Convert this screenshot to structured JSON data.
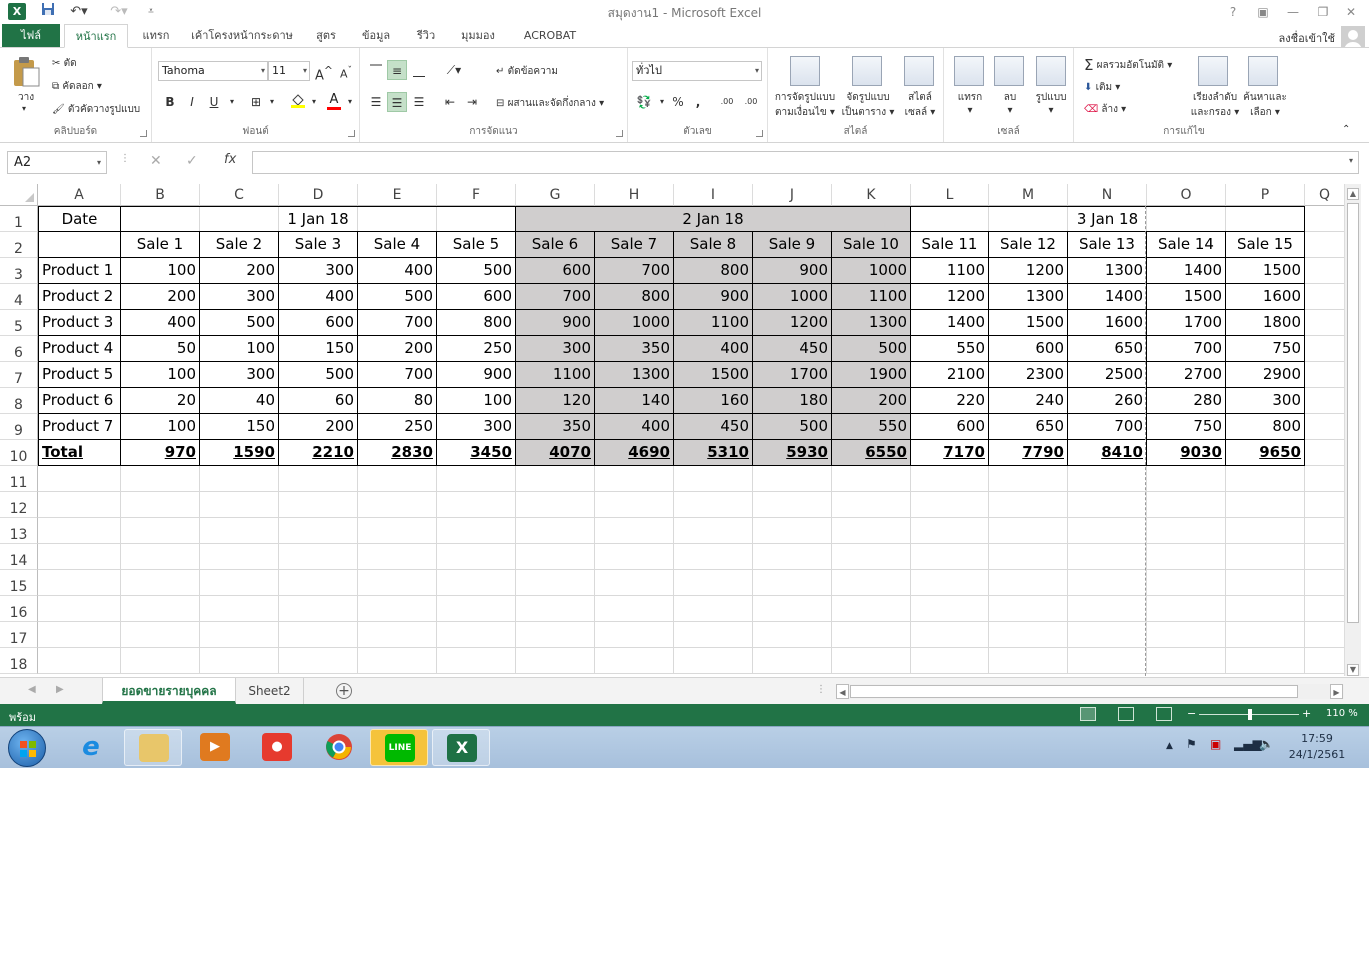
{
  "window": {
    "title": "สมุดงาน1 - Microsoft Excel",
    "app_icon": "X",
    "help": "?",
    "controls": [
      "restore-ribbon",
      "minimize",
      "restore",
      "close"
    ]
  },
  "ribbon_tabs": [
    "ไฟล์",
    "หน้าแรก",
    "แทรก",
    "เค้าโครงหน้ากระดาษ",
    "สูตร",
    "ข้อมูล",
    "รีวิว",
    "มุมมอง",
    "ACROBAT"
  ],
  "signin": "ลงชื่อเข้าใช้",
  "ribbon": {
    "clipboard": {
      "paste": "วาง",
      "cut": "ตัด",
      "copy": "คัดลอก",
      "format_painter": "ตัวคัดวางรูปแบบ",
      "label": "คลิปบอร์ด"
    },
    "font": {
      "name": "Tahoma",
      "size": "11",
      "bold": "B",
      "italic": "I",
      "underline": "U",
      "grow": "A",
      "shrink": "A",
      "font_color_letter": "A",
      "label": "ฟอนต์"
    },
    "alignment": {
      "wrap": "ตัดข้อความ",
      "merge": "ผสานและจัดกึ่งกลาง",
      "label": "การจัดแนว"
    },
    "number": {
      "format": "ทั่วไป",
      "percent": "%",
      "comma": ",",
      "inc": ".00",
      "dec": ".00",
      "label": "ตัวเลข"
    },
    "styles": {
      "cond_1": "การจัดรูปแบบ",
      "cond_2": "ตามเงื่อนไข",
      "table_1": "จัดรูปแบบ",
      "table_2": "เป็นตาราง",
      "cell_1": "สไตล์",
      "cell_2": "เซลล์",
      "label": "สไตล์"
    },
    "cells": {
      "insert": "แทรก",
      "delete": "ลบ",
      "format": "รูปแบบ",
      "label": "เซลล์"
    },
    "editing": {
      "autosum": "ผลรวมอัตโนมัติ",
      "fill": "เติม",
      "clear": "ล้าง",
      "sort_1": "เรียงลำดับ",
      "sort_2": "และกรอง",
      "find_1": "ค้นหาและ",
      "find_2": "เลือก",
      "label": "การแก้ไข"
    }
  },
  "formula_bar": {
    "name_box": "A2",
    "fx": "fx",
    "content": ""
  },
  "sheet": {
    "columns": [
      "A",
      "B",
      "C",
      "D",
      "E",
      "F",
      "G",
      "H",
      "I",
      "J",
      "K",
      "L",
      "M",
      "N",
      "O",
      "P",
      "Q"
    ],
    "row_numbers": [
      "1",
      "2",
      "3",
      "4",
      "5",
      "6",
      "7",
      "8",
      "9",
      "10",
      "11",
      "12",
      "13",
      "14",
      "15",
      "16",
      "17",
      "18"
    ],
    "date_headers": [
      "Date",
      "1 Jan 18",
      "2 Jan 18",
      "3 Jan 18"
    ],
    "sale_headers": [
      "Sale 1",
      "Sale 2",
      "Sale 3",
      "Sale 4",
      "Sale 5",
      "Sale 6",
      "Sale 7",
      "Sale 8",
      "Sale 9",
      "Sale 10",
      "Sale 11",
      "Sale 12",
      "Sale 13",
      "Sale 14",
      "Sale 15"
    ],
    "rows": [
      {
        "label": "Product 1",
        "values": [
          "100",
          "200",
          "300",
          "400",
          "500",
          "600",
          "700",
          "800",
          "900",
          "1000",
          "1100",
          "1200",
          "1300",
          "1400",
          "1500"
        ]
      },
      {
        "label": "Product 2",
        "values": [
          "200",
          "300",
          "400",
          "500",
          "600",
          "700",
          "800",
          "900",
          "1000",
          "1100",
          "1200",
          "1300",
          "1400",
          "1500",
          "1600"
        ]
      },
      {
        "label": "Product 3",
        "values": [
          "400",
          "500",
          "600",
          "700",
          "800",
          "900",
          "1000",
          "1100",
          "1200",
          "1300",
          "1400",
          "1500",
          "1600",
          "1700",
          "1800"
        ]
      },
      {
        "label": "Product 4",
        "values": [
          "50",
          "100",
          "150",
          "200",
          "250",
          "300",
          "350",
          "400",
          "450",
          "500",
          "550",
          "600",
          "650",
          "700",
          "750"
        ]
      },
      {
        "label": "Product 5",
        "values": [
          "100",
          "300",
          "500",
          "700",
          "900",
          "1100",
          "1300",
          "1500",
          "1700",
          "1900",
          "2100",
          "2300",
          "2500",
          "2700",
          "2900"
        ]
      },
      {
        "label": "Product 6",
        "values": [
          "20",
          "40",
          "60",
          "80",
          "100",
          "120",
          "140",
          "160",
          "180",
          "200",
          "220",
          "240",
          "260",
          "280",
          "300"
        ]
      },
      {
        "label": "Product 7",
        "values": [
          "100",
          "150",
          "200",
          "250",
          "300",
          "350",
          "400",
          "450",
          "500",
          "550",
          "600",
          "650",
          "700",
          "750",
          "800"
        ]
      }
    ],
    "total": {
      "label": "Total",
      "values": [
        "970",
        "1590",
        "2210",
        "2830",
        "3450",
        "4070",
        "4690",
        "5310",
        "5930",
        "6550",
        "7170",
        "7790",
        "8410",
        "9030",
        "9650"
      ]
    },
    "highlight_color": "#d0cece",
    "selected_cell": "A2"
  },
  "sheet_tabs": [
    "ยอดขายรายบุคคล",
    "Sheet2"
  ],
  "status": {
    "ready": "พร้อม",
    "zoom": "110 %",
    "zoom_minus": "−",
    "zoom_plus": "+"
  },
  "taskbar": {
    "apps": [
      "start-orb",
      "internet-explorer",
      "file-explorer",
      "media-player",
      "bandicam",
      "chrome",
      "line",
      "excel"
    ],
    "time": "17:59",
    "date": "24/1/2561"
  },
  "colors": {
    "excel_green": "#217346",
    "header_fill": "#d0cece"
  }
}
